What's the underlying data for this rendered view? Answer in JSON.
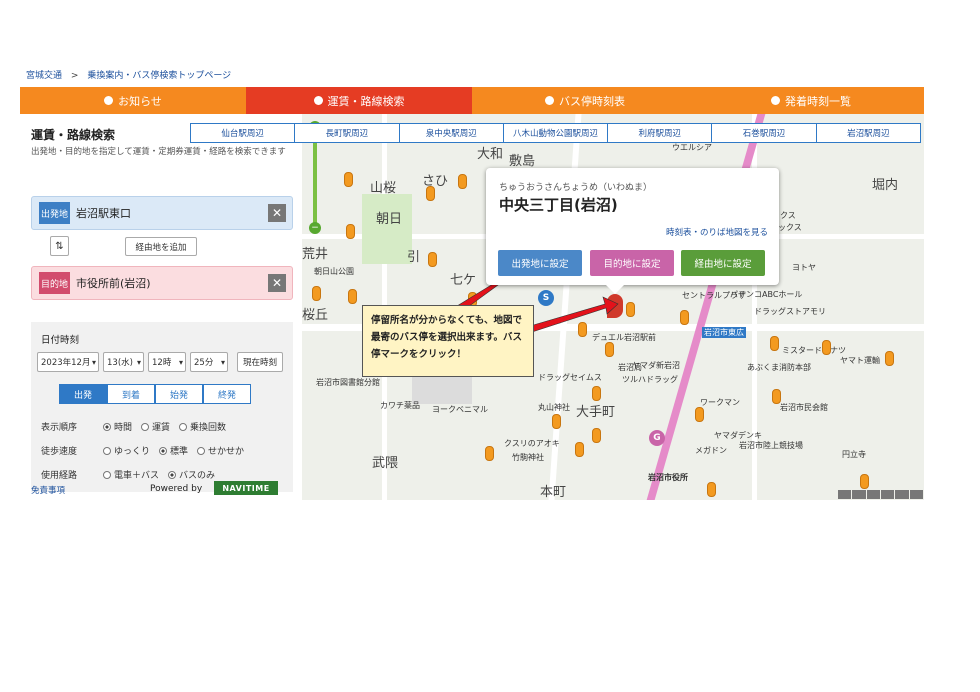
{
  "breadcrumb": [
    "宮城交通",
    "乗換案内・バス停検索トップページ"
  ],
  "navbar": [
    {
      "label": "お知らせ"
    },
    {
      "label": "運賃・路線検索",
      "active": true
    },
    {
      "label": "バス停時刻表"
    },
    {
      "label": "発着時刻一覧"
    }
  ],
  "area_tabs": [
    "仙台駅周辺",
    "長町駅周辺",
    "泉中央駅周辺",
    "八木山動物公園駅周辺",
    "利府駅周辺",
    "石巻駅周辺",
    "岩沼駅周辺"
  ],
  "sidebar": {
    "title": "運賃・路線検索",
    "desc": "出発地・目的地を指定して運賃・定期券運賃・経路を検索できます",
    "departure_label": "出発地",
    "departure_value": "岩沼駅東口",
    "swap": "⇅",
    "via_button": "経由地を追加",
    "destination_label": "目的地",
    "destination_value": "市役所前(岩沼)",
    "clear": "✕",
    "datetime_title": "日付時刻",
    "date": {
      "month": "2023年12月",
      "day": "13(水)",
      "hour": "12時",
      "minute": "25分"
    },
    "now_button": "現在時刻",
    "modes": [
      "出発",
      "到着",
      "始発",
      "終発"
    ],
    "options": [
      {
        "label": "表示順序",
        "choices": [
          "時間",
          "運賃",
          "乗換回数"
        ],
        "selected": 0
      },
      {
        "label": "徒歩速度",
        "choices": [
          "ゆっくり",
          "標準",
          "せかせか"
        ],
        "selected": 1
      },
      {
        "label": "使用経路",
        "choices": [
          "電車＋バス",
          "バスのみ"
        ],
        "selected": 1
      }
    ]
  },
  "footer": {
    "disclaimer": "免責事項",
    "powered": "Powered by",
    "logo": "NAVITIME"
  },
  "popup": {
    "kana": "ちゅうおうさんちょうめ（いわぬま）",
    "name": "中央三丁目(岩沼)",
    "link": "時刻表・のりば地図を見る",
    "buttons": [
      "出発地に設定",
      "目的地に設定",
      "経由地に設定"
    ]
  },
  "note": "停留所名が分からなくても、地図で最寄のバス停を選択出来ます。バス停マークをクリック！",
  "map": {
    "areas": [
      "大和",
      "敷島",
      "山桜",
      "さひ",
      "朝日",
      "荒井",
      "引",
      "七ケ",
      "桜丘",
      "武隈",
      "大手町",
      "本町",
      "堀内"
    ],
    "pois": [
      "岩沼市図書館分館",
      "岩沼市役所",
      "岩沼市東広",
      "カワチ薬品",
      "ヨークベニマル",
      "ドラッグセイムス",
      "ツルハドラッグ",
      "竹駒神社",
      "丸山神社",
      "ワークマン",
      "ヤマダデンキ",
      "メガドン",
      "岩沼市陸上競技場",
      "岩沼市民会館",
      "ドラッグストアモリ",
      "パチンコABCホール",
      "ミスタードーナツ",
      "ヤマト運輸",
      "あぶくま消防本部",
      "円立寺",
      "朝日山公園",
      "クスリのアオキ",
      "ウエルシア",
      "ヤマダ新岩沼",
      "デュエル岩沼駅前",
      "岩沼局",
      "ヨトヤ",
      "ックス",
      "ックス",
      "セントラルプラザ"
    ]
  },
  "colors": {
    "nav_orange": "#f5891f",
    "nav_active": "#e53c23",
    "departure": "#3d7fc5",
    "destination": "#d24c6d",
    "btn_via": "#5a9d3a"
  }
}
